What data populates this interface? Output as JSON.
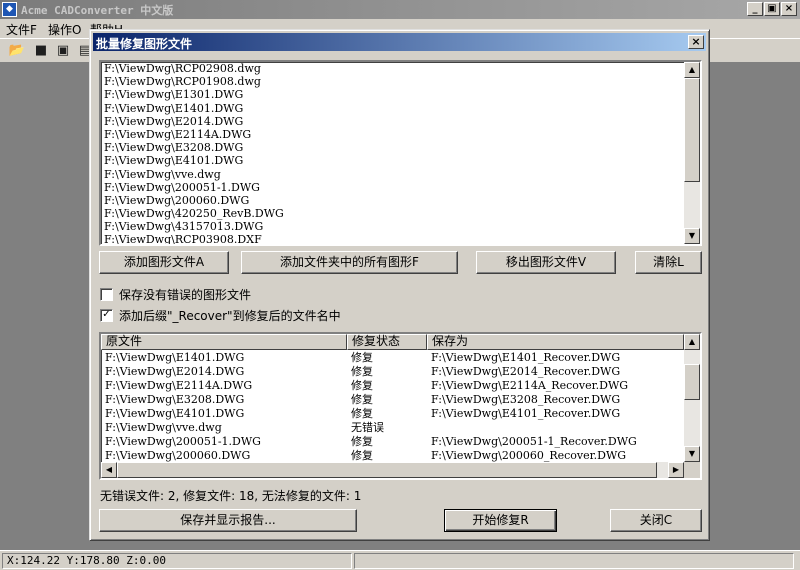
{
  "app": {
    "title": "Acme CADConverter 中文版",
    "icon": "app-icon",
    "window_buttons": [
      "_",
      "▣",
      "×"
    ]
  },
  "menu": [
    "文件F",
    "操作O",
    "帮助H"
  ],
  "toolbar": [
    "open-folder-icon",
    "save-icon",
    "save-as-icon",
    "copy-icon"
  ],
  "statusbar": {
    "coords": "X:124.22 Y:178.80 Z:0.00"
  },
  "dialog": {
    "title": "批量修复图形文件",
    "close_label": "×",
    "files": [
      "F:\\ViewDwg\\RCP02908.dwg",
      "F:\\ViewDwg\\RCP01908.dwg",
      "F:\\ViewDwg\\E1301.DWG",
      "F:\\ViewDwg\\E1401.DWG",
      "F:\\ViewDwg\\E2014.DWG",
      "F:\\ViewDwg\\E2114A.DWG",
      "F:\\ViewDwg\\E3208.DWG",
      "F:\\ViewDwg\\E4101.DWG",
      "F:\\ViewDwg\\vve.dwg",
      "F:\\ViewDwg\\200051-1.DWG",
      "F:\\ViewDwg\\200060.DWG",
      "F:\\ViewDwg\\420250_RevB.DWG",
      "F:\\ViewDwg\\43157013.DWG",
      "F:\\ViewDwg\\RCP03908.DXF"
    ],
    "buttons": {
      "add_file": "添加图形文件A",
      "add_folder": "添加文件夹中的所有图形F",
      "remove": "移出图形文件V",
      "clear": "清除L"
    },
    "options": {
      "save_no_error": {
        "label": "保存没有错误的图形文件",
        "checked": false
      },
      "add_suffix": {
        "label": "添加后缀\"_Recover\"到修复后的文件名中",
        "checked": true
      }
    },
    "results": {
      "columns": [
        "原文件",
        "修复状态",
        "保存为"
      ],
      "rows": [
        {
          "source": "F:\\ViewDwg\\E1401.DWG",
          "status": "修复",
          "saved_as": "F:\\ViewDwg\\E1401_Recover.DWG"
        },
        {
          "source": "F:\\ViewDwg\\E2014.DWG",
          "status": "修复",
          "saved_as": "F:\\ViewDwg\\E2014_Recover.DWG"
        },
        {
          "source": "F:\\ViewDwg\\E2114A.DWG",
          "status": "修复",
          "saved_as": "F:\\ViewDwg\\E2114A_Recover.DWG"
        },
        {
          "source": "F:\\ViewDwg\\E3208.DWG",
          "status": "修复",
          "saved_as": "F:\\ViewDwg\\E3208_Recover.DWG"
        },
        {
          "source": "F:\\ViewDwg\\E4101.DWG",
          "status": "修复",
          "saved_as": "F:\\ViewDwg\\E4101_Recover.DWG"
        },
        {
          "source": "F:\\ViewDwg\\vve.dwg",
          "status": "无错误",
          "saved_as": ""
        },
        {
          "source": "F:\\ViewDwg\\200051-1.DWG",
          "status": "修复",
          "saved_as": "F:\\ViewDwg\\200051-1_Recover.DWG"
        },
        {
          "source": "F:\\ViewDwg\\200060.DWG",
          "status": "修复",
          "saved_as": "F:\\ViewDwg\\200060_Recover.DWG"
        }
      ]
    },
    "summary": "无错误文件: 2, 修复文件: 18, 无法修复的文件: 1",
    "footer_buttons": {
      "save_report": "保存并显示报告...",
      "start": "开始修复R",
      "close": "关闭C"
    }
  }
}
